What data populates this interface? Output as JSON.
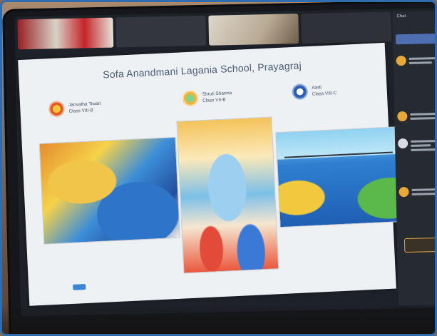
{
  "slide": {
    "title": "Sofa Anandmani Lagania School, Prayagraj",
    "cards": [
      {
        "line1": "Janvatha Tiwari",
        "line2": "Class VIII-B"
      },
      {
        "line1": "Shruti Sharma",
        "line2": "Class VII-B"
      },
      {
        "line1": "Aarti",
        "line2": "Class VIII-C"
      }
    ]
  },
  "chat": {
    "title": "Chat"
  },
  "colors": {
    "accent": "#4d6fb1",
    "frame": "#2f6db0",
    "button": "#3c86d6"
  }
}
